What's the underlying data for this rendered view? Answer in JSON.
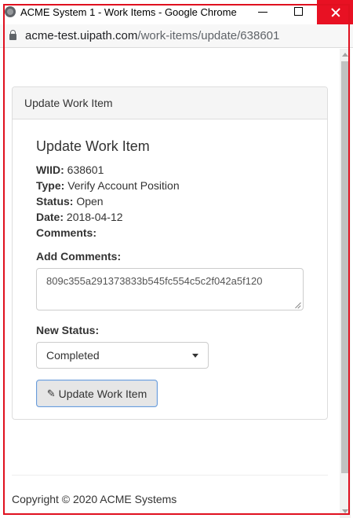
{
  "window": {
    "title": "ACME System 1 - Work Items - Google Chrome",
    "favicon_icon": "globe-icon",
    "close_color": "#e81123"
  },
  "address_bar": {
    "host": "acme-test.uipath.com",
    "path": "/work-items/update/638601",
    "lock_icon": "lock-icon"
  },
  "panel": {
    "heading": "Update Work Item"
  },
  "work_item": {
    "title": "Update Work Item",
    "wiid_label": "WIID:",
    "wiid": "638601",
    "type_label": "Type:",
    "type": "Verify Account Position",
    "status_label": "Status:",
    "status": "Open",
    "date_label": "Date:",
    "date": "2018-04-12",
    "comments_label": "Comments:",
    "comments": ""
  },
  "form": {
    "add_comments_label": "Add Comments:",
    "add_comments_value": "809c355a291373833b545fc554c5c2f042a5f120",
    "new_status_label": "New Status:",
    "new_status_selected": "Completed",
    "submit_label": "Update Work Item",
    "submit_icon": "pencil-icon"
  },
  "footer": {
    "copyright": "Copyright © 2020 ACME Systems"
  },
  "colors": {
    "highlight_frame": "#e0101f",
    "button_focus_border": "#6a9bd8",
    "panel_heading_bg": "#f5f5f5"
  }
}
